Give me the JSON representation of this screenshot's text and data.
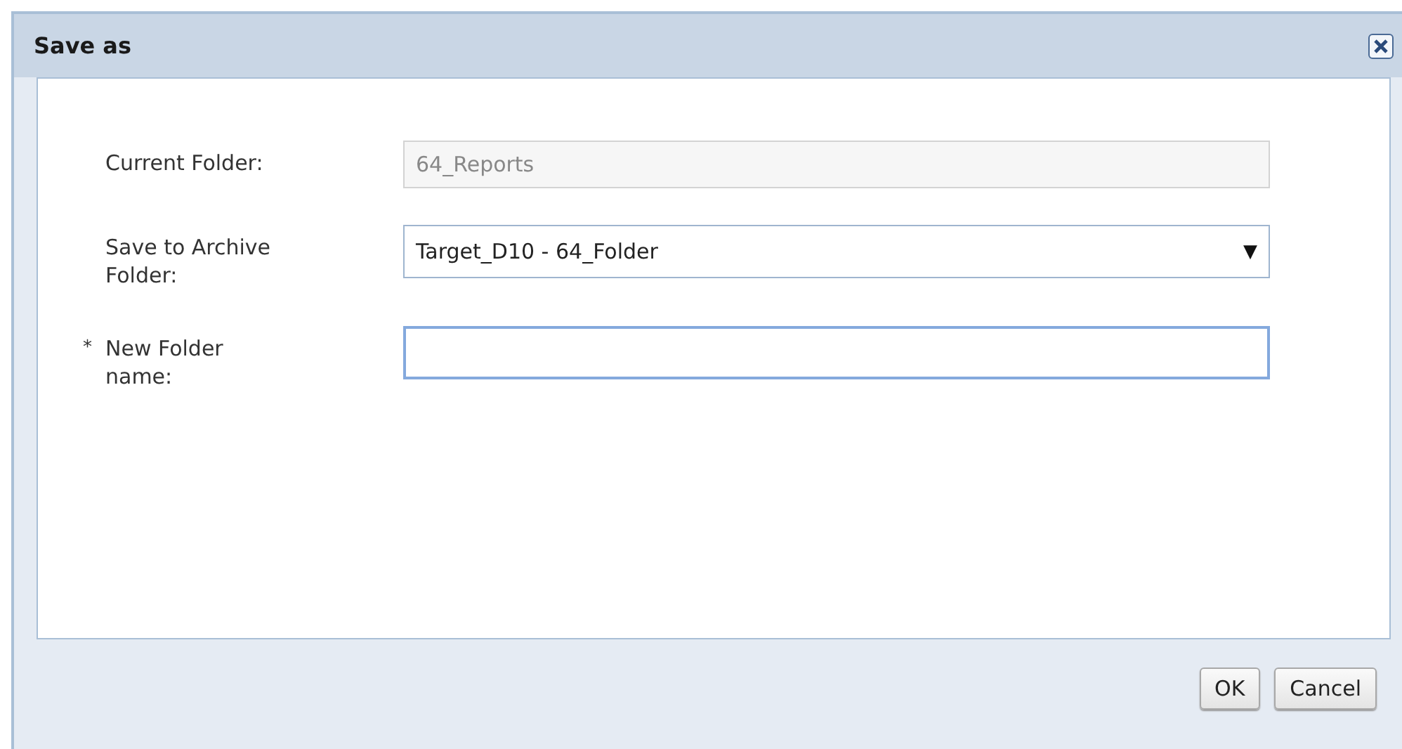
{
  "window": {
    "title": "Save as"
  },
  "fields": [
    {
      "kind": "readonly",
      "label": "Current Folder:",
      "value": "64_Reports",
      "disabled": true
    },
    {
      "kind": "dropdown",
      "label": "Save to Archive Folder:",
      "value": "Target_D10 - 64_Folder",
      "caret": "▼",
      "disabled": false
    },
    {
      "kind": "text",
      "label": "New Folder name:",
      "required_mark": "*",
      "focused": true,
      "disabled": false
    }
  ],
  "buttons": [
    "OK",
    "Cancel"
  ]
}
